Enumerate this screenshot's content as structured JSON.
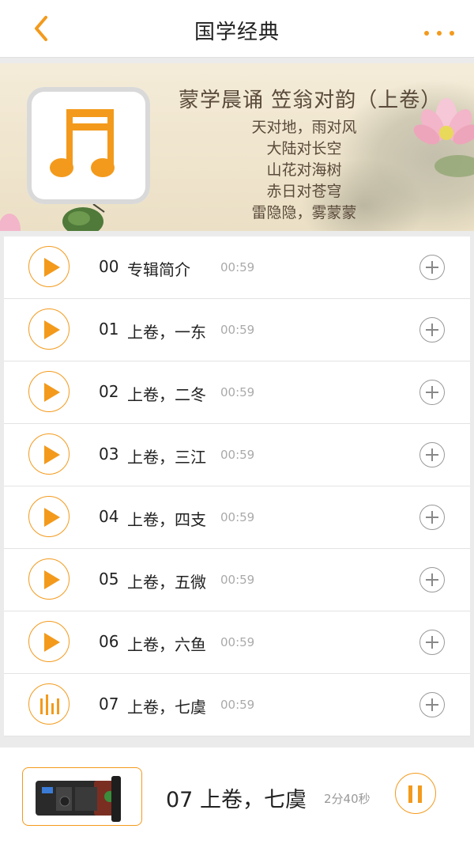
{
  "header": {
    "title": "国学经典",
    "back_icon": "chevron-left-icon",
    "more_icon": "more-dots-icon"
  },
  "colors": {
    "accent": "#f39a1c",
    "background": "#ebebeb"
  },
  "album": {
    "title": "蒙学晨诵  笠翁对韵（上卷）",
    "cover_icon": "music-note-icon",
    "poem_lines": [
      "天对地，雨对风",
      "大陆对长空",
      "山花对海树",
      "赤日对苍穹",
      "雷隐隐，雾蒙蒙"
    ]
  },
  "tracks": [
    {
      "num": "00",
      "name": "专辑简介",
      "duration": "00:59",
      "state": "play"
    },
    {
      "num": "01",
      "name": "上卷，一东",
      "duration": "00:59",
      "state": "play"
    },
    {
      "num": "02",
      "name": "上卷，二冬",
      "duration": "00:59",
      "state": "play"
    },
    {
      "num": "03",
      "name": "上卷，三江",
      "duration": "00:59",
      "state": "play"
    },
    {
      "num": "04",
      "name": "上卷，四支",
      "duration": "00:59",
      "state": "play"
    },
    {
      "num": "05",
      "name": "上卷，五微",
      "duration": "00:59",
      "state": "play"
    },
    {
      "num": "06",
      "name": "上卷，六鱼",
      "duration": "00:59",
      "state": "play"
    },
    {
      "num": "07",
      "name": "上卷，七虞",
      "duration": "00:59",
      "state": "playing"
    }
  ],
  "player": {
    "track": "07  上卷，七虞",
    "time": "2分40秒",
    "thumb": "radio-device-image",
    "pause_icon": "pause-icon"
  }
}
